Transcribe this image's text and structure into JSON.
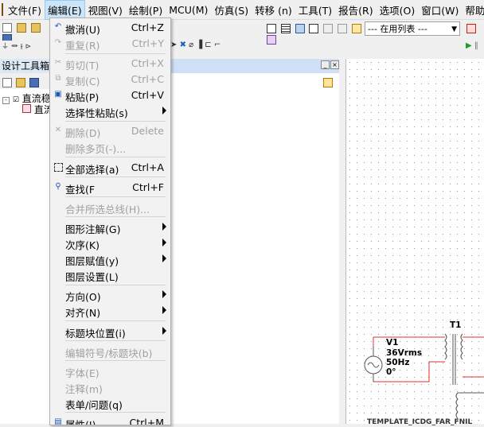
{
  "menubar": {
    "items": [
      {
        "label": "文件(F)"
      },
      {
        "label": "编辑(E)"
      },
      {
        "label": "视图(V)"
      },
      {
        "label": "绘制(P)"
      },
      {
        "label": "MCU(M)"
      },
      {
        "label": "仿真(S)"
      },
      {
        "label": "转移 (n)"
      },
      {
        "label": "工具(T)"
      },
      {
        "label": "报告(R)"
      },
      {
        "label": "选项(O)"
      },
      {
        "label": "窗口(W)"
      },
      {
        "label": "帮助(H)"
      }
    ]
  },
  "toolbar": {
    "in_use_list": "--- 在用列表 ---"
  },
  "left_panel": {
    "title": "设计工具箱",
    "tree": [
      "直流稳",
      "直流"
    ]
  },
  "edit_menu": {
    "items": [
      {
        "label": "撤消(U)",
        "shortcut": "Ctrl+Z",
        "icon": "undo-icon",
        "enabled": true
      },
      {
        "label": "重复(R)",
        "shortcut": "Ctrl+Y",
        "icon": "redo-icon",
        "enabled": false
      },
      {
        "label": "剪切(T)",
        "shortcut": "Ctrl+X",
        "icon": "cut-icon",
        "enabled": false
      },
      {
        "label": "复制(C)",
        "shortcut": "Ctrl+C",
        "icon": "copy-icon",
        "enabled": false
      },
      {
        "label": "粘贴(P)",
        "shortcut": "Ctrl+V",
        "icon": "paste-icon",
        "enabled": true
      },
      {
        "label": "选择性粘贴(s)",
        "shortcut": "",
        "icon": "",
        "enabled": true,
        "submenu": true
      },
      {
        "label": "删除(D)",
        "shortcut": "Delete",
        "icon": "delete-icon",
        "enabled": false
      },
      {
        "label": "删除多页(-)...",
        "shortcut": "",
        "icon": "",
        "enabled": false
      },
      {
        "label": "全部选择(a)",
        "shortcut": "Ctrl+A",
        "icon": "select-all-icon",
        "enabled": true
      },
      {
        "label": "查找(F",
        "shortcut": "Ctrl+F",
        "icon": "find-icon",
        "enabled": true
      },
      {
        "label": "合并所选总线(H)...",
        "shortcut": "",
        "icon": "",
        "enabled": false
      },
      {
        "label": "图形注解(G)",
        "shortcut": "",
        "icon": "",
        "enabled": true,
        "submenu": true
      },
      {
        "label": "次序(K)",
        "shortcut": "",
        "icon": "",
        "enabled": true,
        "submenu": true
      },
      {
        "label": "图层赋值(y)",
        "shortcut": "",
        "icon": "",
        "enabled": true,
        "submenu": true
      },
      {
        "label": "图层设置(L)",
        "shortcut": "",
        "icon": "",
        "enabled": true
      },
      {
        "label": "方向(O)",
        "shortcut": "",
        "icon": "",
        "enabled": true,
        "submenu": true
      },
      {
        "label": "对齐(N)",
        "shortcut": "",
        "icon": "",
        "enabled": true,
        "submenu": true
      },
      {
        "label": "标题块位置(i)",
        "shortcut": "",
        "icon": "",
        "enabled": true,
        "submenu": true
      },
      {
        "label": "编辑符号/标题块(b)",
        "shortcut": "",
        "icon": "",
        "enabled": false
      },
      {
        "label": "字体(E)",
        "shortcut": "",
        "icon": "",
        "enabled": false
      },
      {
        "label": "注释(m)",
        "shortcut": "",
        "icon": "",
        "enabled": false
      },
      {
        "label": "表单/问题(q)",
        "shortcut": "",
        "icon": "",
        "enabled": true
      },
      {
        "label": "属性(I)",
        "shortcut": "Ctrl+M",
        "icon": "properties-icon",
        "enabled": true
      }
    ]
  },
  "schematic": {
    "transformer_label": "T1",
    "source_name": "V1",
    "source_voltage": "36Vrms",
    "source_freq": "50Hz",
    "source_phase": "0°",
    "bottom_text": "TEMPLATE_ICDG_FAR_FNIL"
  },
  "colors": {
    "menu_highlight": "#cce4f7",
    "wire_red": "#e03030",
    "disabled_text": "#a0a0a0"
  }
}
